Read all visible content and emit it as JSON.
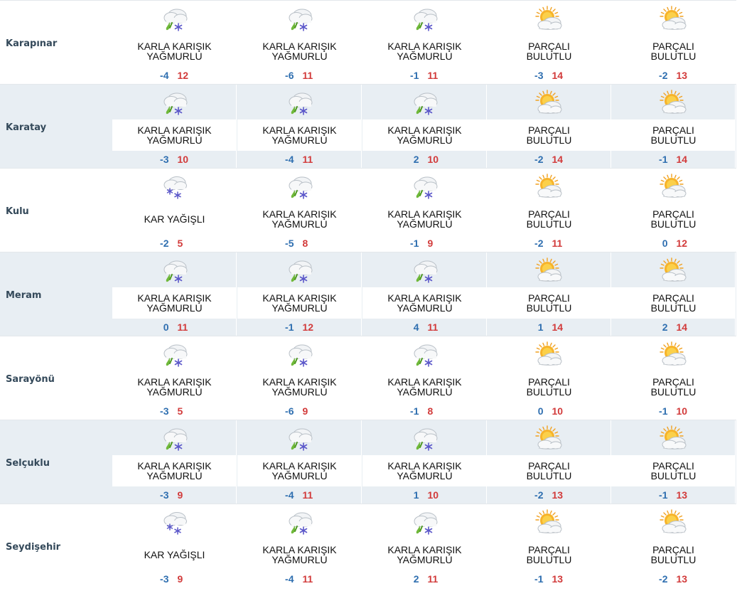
{
  "rows": [
    {
      "name": "Karapınar",
      "days": [
        {
          "icon": "sleet-icon",
          "desc": "KARLA KARIŞIK YAĞMURLU",
          "min": "-4",
          "max": "12"
        },
        {
          "icon": "sleet-icon",
          "desc": "KARLA KARIŞIK YAĞMURLU",
          "min": "-6",
          "max": "11"
        },
        {
          "icon": "sleet-icon",
          "desc": "KARLA KARIŞIK YAĞMURLU",
          "min": "-1",
          "max": "11"
        },
        {
          "icon": "partly-cloudy-icon",
          "desc": "PARÇALI BULUTLU",
          "min": "-3",
          "max": "14"
        },
        {
          "icon": "partly-cloudy-icon",
          "desc": "PARÇALI BULUTLU",
          "min": "-2",
          "max": "13"
        }
      ]
    },
    {
      "name": "Karatay",
      "days": [
        {
          "icon": "sleet-icon",
          "desc": "KARLA KARIŞIK YAĞMURLU",
          "min": "-3",
          "max": "10"
        },
        {
          "icon": "sleet-icon",
          "desc": "KARLA KARIŞIK YAĞMURLU",
          "min": "-4",
          "max": "11"
        },
        {
          "icon": "sleet-icon",
          "desc": "KARLA KARIŞIK YAĞMURLU",
          "min": "2",
          "max": "10"
        },
        {
          "icon": "partly-cloudy-icon",
          "desc": "PARÇALI BULUTLU",
          "min": "-2",
          "max": "14"
        },
        {
          "icon": "partly-cloudy-icon",
          "desc": "PARÇALI BULUTLU",
          "min": "-1",
          "max": "14"
        }
      ]
    },
    {
      "name": "Kulu",
      "days": [
        {
          "icon": "snow-icon",
          "desc": "KAR YAĞIŞLI",
          "min": "-2",
          "max": "5"
        },
        {
          "icon": "sleet-icon",
          "desc": "KARLA KARIŞIK YAĞMURLU",
          "min": "-5",
          "max": "8"
        },
        {
          "icon": "sleet-icon",
          "desc": "KARLA KARIŞIK YAĞMURLU",
          "min": "-1",
          "max": "9"
        },
        {
          "icon": "partly-cloudy-icon",
          "desc": "PARÇALI BULUTLU",
          "min": "-2",
          "max": "11"
        },
        {
          "icon": "partly-cloudy-icon",
          "desc": "PARÇALI BULUTLU",
          "min": "0",
          "max": "12"
        }
      ]
    },
    {
      "name": "Meram",
      "days": [
        {
          "icon": "sleet-icon",
          "desc": "KARLA KARIŞIK YAĞMURLU",
          "min": "0",
          "max": "11"
        },
        {
          "icon": "sleet-icon",
          "desc": "KARLA KARIŞIK YAĞMURLU",
          "min": "-1",
          "max": "12"
        },
        {
          "icon": "sleet-icon",
          "desc": "KARLA KARIŞIK YAĞMURLU",
          "min": "4",
          "max": "11"
        },
        {
          "icon": "partly-cloudy-icon",
          "desc": "PARÇALI BULUTLU",
          "min": "1",
          "max": "14"
        },
        {
          "icon": "partly-cloudy-icon",
          "desc": "PARÇALI BULUTLU",
          "min": "2",
          "max": "14"
        }
      ]
    },
    {
      "name": "Sarayönü",
      "days": [
        {
          "icon": "sleet-icon",
          "desc": "KARLA KARIŞIK YAĞMURLU",
          "min": "-3",
          "max": "5"
        },
        {
          "icon": "sleet-icon",
          "desc": "KARLA KARIŞIK YAĞMURLU",
          "min": "-6",
          "max": "9"
        },
        {
          "icon": "sleet-icon",
          "desc": "KARLA KARIŞIK YAĞMURLU",
          "min": "-1",
          "max": "8"
        },
        {
          "icon": "partly-cloudy-icon",
          "desc": "PARÇALI BULUTLU",
          "min": "0",
          "max": "10"
        },
        {
          "icon": "partly-cloudy-icon",
          "desc": "PARÇALI BULUTLU",
          "min": "-1",
          "max": "10"
        }
      ]
    },
    {
      "name": "Selçuklu",
      "days": [
        {
          "icon": "sleet-icon",
          "desc": "KARLA KARIŞIK YAĞMURLU",
          "min": "-3",
          "max": "9"
        },
        {
          "icon": "sleet-icon",
          "desc": "KARLA KARIŞIK YAĞMURLU",
          "min": "-4",
          "max": "11"
        },
        {
          "icon": "sleet-icon",
          "desc": "KARLA KARIŞIK YAĞMURLU",
          "min": "1",
          "max": "10"
        },
        {
          "icon": "partly-cloudy-icon",
          "desc": "PARÇALI BULUTLU",
          "min": "-2",
          "max": "13"
        },
        {
          "icon": "partly-cloudy-icon",
          "desc": "PARÇALI BULUTLU",
          "min": "-1",
          "max": "13"
        }
      ]
    },
    {
      "name": "Seydişehir",
      "days": [
        {
          "icon": "snow-icon",
          "desc": "KAR YAĞIŞLI",
          "min": "-3",
          "max": "9"
        },
        {
          "icon": "sleet-icon",
          "desc": "KARLA KARIŞIK YAĞMURLU",
          "min": "-4",
          "max": "11"
        },
        {
          "icon": "sleet-icon",
          "desc": "KARLA KARIŞIK YAĞMURLU",
          "min": "2",
          "max": "11"
        },
        {
          "icon": "partly-cloudy-icon",
          "desc": "PARÇALI BULUTLU",
          "min": "-1",
          "max": "13"
        },
        {
          "icon": "partly-cloudy-icon",
          "desc": "PARÇALI BULUTLU",
          "min": "-2",
          "max": "13"
        }
      ]
    }
  ],
  "colors": {
    "min_temp": "#2f6fb0",
    "max_temp": "#d23b3b",
    "row_stripe": "#e8eef3",
    "city_name": "#34495a"
  }
}
